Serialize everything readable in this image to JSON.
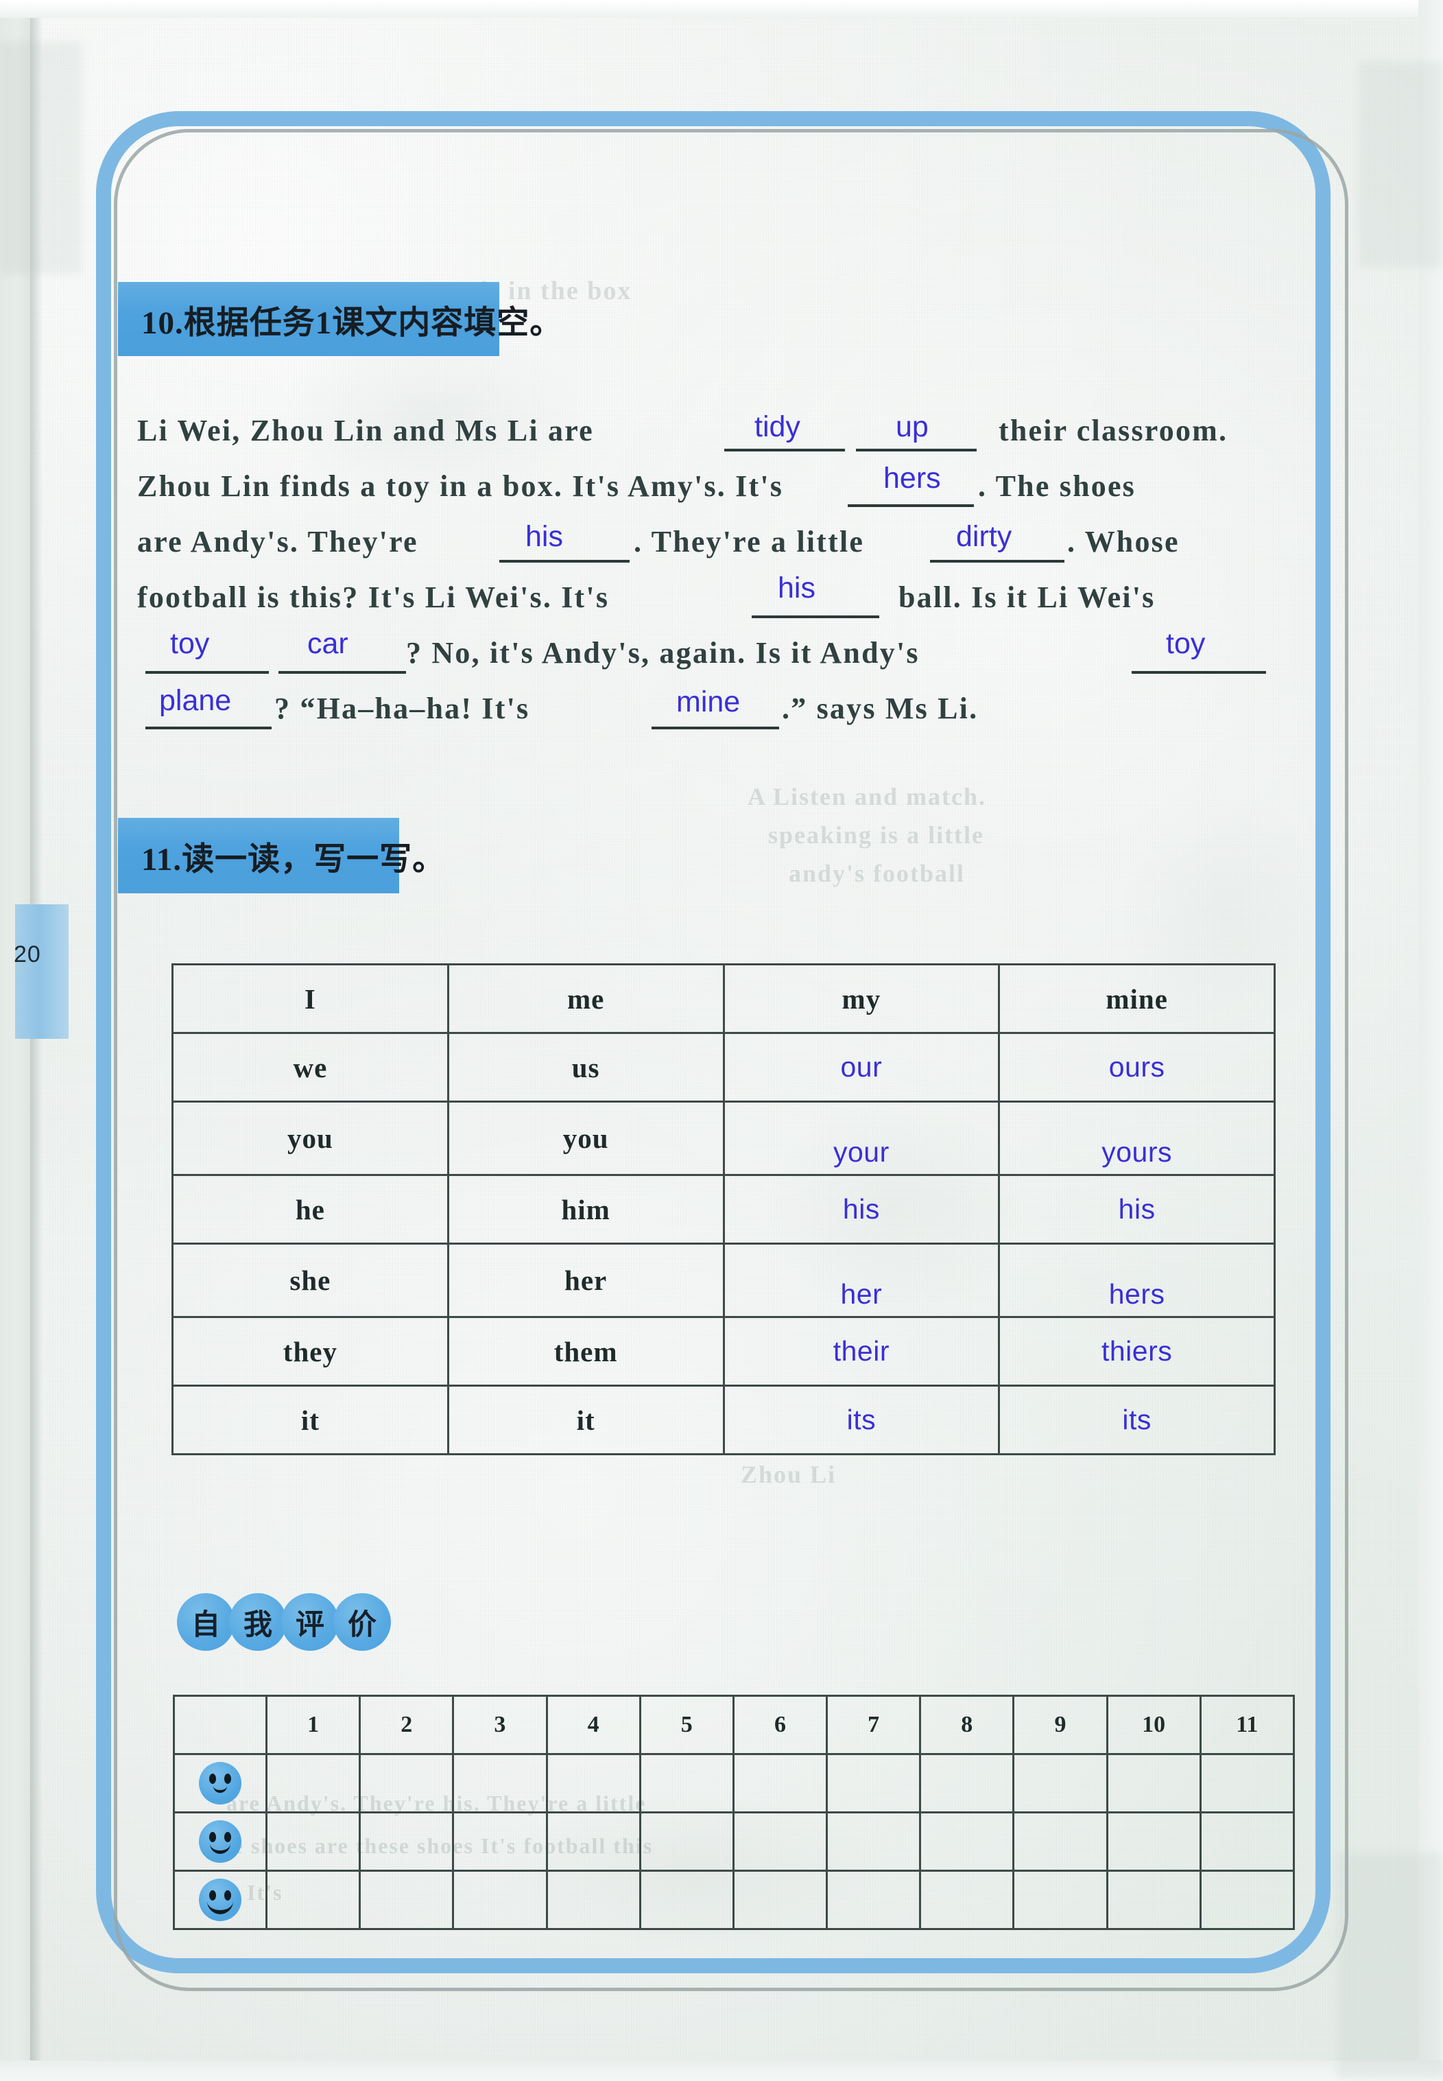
{
  "page": {
    "page_number": "20"
  },
  "exercise10": {
    "heading": "10.根据任务1课文内容填空。",
    "lines": [
      {
        "segments": [
          {
            "type": "text",
            "value": "Li Wei, Zhou Lin and Ms Li are"
          },
          {
            "type": "blank",
            "answer": "tidy"
          },
          {
            "type": "blank",
            "answer": "up"
          },
          {
            "type": "text",
            "value": "their classroom."
          }
        ]
      },
      {
        "segments": [
          {
            "type": "text",
            "value": "Zhou Lin finds a toy in a box. It's Amy's. It's"
          },
          {
            "type": "blank",
            "answer": "hers"
          },
          {
            "type": "text",
            "value": ". The shoes"
          }
        ]
      },
      {
        "segments": [
          {
            "type": "text",
            "value": "are Andy's. They're"
          },
          {
            "type": "blank",
            "answer": "his"
          },
          {
            "type": "text",
            "value": ". They're a little"
          },
          {
            "type": "blank",
            "answer": "dirty"
          },
          {
            "type": "text",
            "value": ". Whose"
          }
        ]
      },
      {
        "segments": [
          {
            "type": "text",
            "value": "football is this? It's Li Wei's. It's"
          },
          {
            "type": "blank",
            "answer": "his"
          },
          {
            "type": "text",
            "value": "ball. Is it Li Wei's"
          }
        ]
      },
      {
        "segments": [
          {
            "type": "blank",
            "answer": "toy"
          },
          {
            "type": "blank",
            "answer": "car"
          },
          {
            "type": "text",
            "value": "? No, it's Andy's, again. Is it Andy's"
          },
          {
            "type": "blank",
            "answer": "toy"
          }
        ]
      },
      {
        "segments": [
          {
            "type": "blank",
            "answer": "plane"
          },
          {
            "type": "text",
            "value": "? “Ha–ha–ha! It's"
          },
          {
            "type": "blank",
            "answer": "mine"
          },
          {
            "type": "text",
            "value": ".” says Ms Li."
          }
        ]
      }
    ],
    "line_text": {
      "l1_a": "Li Wei, Zhou Lin and Ms Li are",
      "l1_b": "their classroom.",
      "l1_ans1": "tidy",
      "l1_ans2": "up",
      "l2_a": "Zhou Lin finds a toy in a box. It's Amy's. It's",
      "l2_b": ". The shoes",
      "l2_ans1": "hers",
      "l3_a": "are Andy's. They're",
      "l3_b": ". They're a little",
      "l3_c": ". Whose",
      "l3_ans1": "his",
      "l3_ans2": "dirty",
      "l4_a": "football is this? It's Li Wei's. It's",
      "l4_b": "ball. Is it Li Wei's",
      "l4_ans1": "his",
      "l5_a": "? No, it's Andy's, again. Is it Andy's",
      "l5_ans1": "toy",
      "l5_ans2": "car",
      "l5_ans3": "toy",
      "l6_a": "? “Ha–ha–ha! It's",
      "l6_b": ".”   says Ms Li.",
      "l6_ans1": "plane",
      "l6_ans2": "mine"
    }
  },
  "exercise11": {
    "heading": "11.读一读，写一写。",
    "table": {
      "rows": [
        {
          "subject": "I",
          "object": "me",
          "possessive_adj": "my",
          "possessive_pron": "mine",
          "adj_written": false,
          "pron_written": false
        },
        {
          "subject": "we",
          "object": "us",
          "possessive_adj": "our",
          "possessive_pron": "ours",
          "adj_written": true,
          "pron_written": true
        },
        {
          "subject": "you",
          "object": "you",
          "possessive_adj": "your",
          "possessive_pron": "yours",
          "adj_written": true,
          "pron_written": true
        },
        {
          "subject": "he",
          "object": "him",
          "possessive_adj": "his",
          "possessive_pron": "his",
          "adj_written": true,
          "pron_written": true
        },
        {
          "subject": "she",
          "object": "her",
          "possessive_adj": "her",
          "possessive_pron": "hers",
          "adj_written": true,
          "pron_written": true
        },
        {
          "subject": "they",
          "object": "them",
          "possessive_adj": "their",
          "possessive_pron": "thiers",
          "adj_written": true,
          "pron_written": true
        },
        {
          "subject": "it",
          "object": "it",
          "possessive_adj": "its",
          "possessive_pron": "its",
          "adj_written": true,
          "pron_written": true
        }
      ]
    }
  },
  "self_evaluation": {
    "badge_chars": [
      "自",
      "我",
      "评",
      "价"
    ],
    "columns": [
      "1",
      "2",
      "3",
      "4",
      "5",
      "6",
      "7",
      "8",
      "9",
      "10",
      "11"
    ],
    "rating_rows": [
      {
        "icon": "smiley-slight-icon"
      },
      {
        "icon": "smiley-medium-icon"
      },
      {
        "icon": "smiley-big-icon"
      }
    ]
  },
  "colors": {
    "banner_blue": "#4ea2de",
    "frame_blue": "#7db8e3",
    "handwriting_blue": "#3a2fd6",
    "print_black": "#1f2b2a",
    "paper": "#eef2ef"
  }
}
